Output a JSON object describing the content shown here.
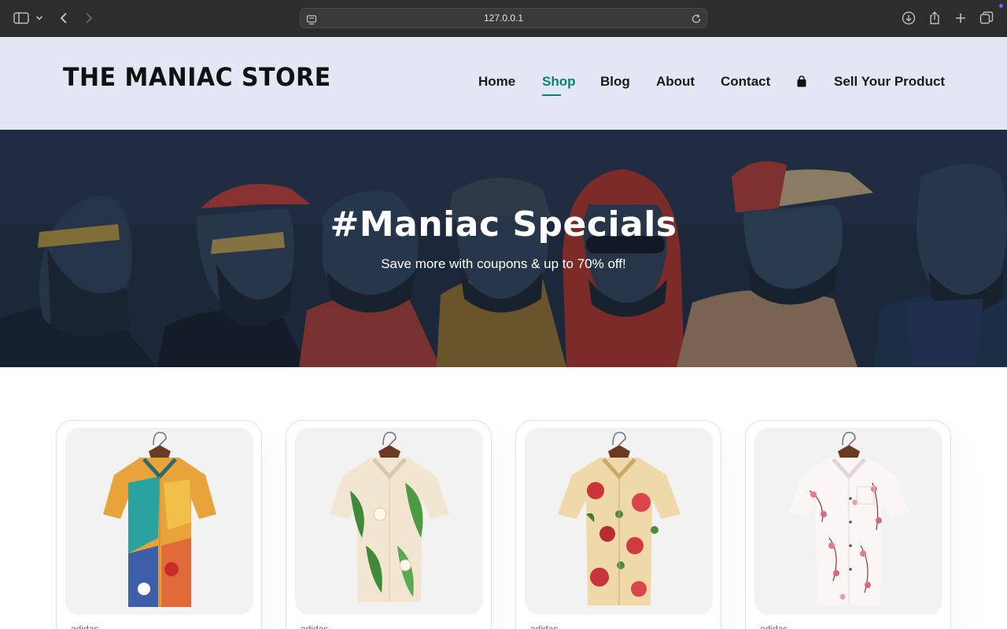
{
  "browser": {
    "url": "127.0.0.1",
    "icons": [
      "sidebar-icon",
      "chevron-down-icon",
      "back-icon",
      "forward-icon",
      "page-icon",
      "reload-icon",
      "download-icon",
      "share-icon",
      "new-tab-icon",
      "tabs-overview-icon"
    ]
  },
  "header": {
    "logo": "THE MANIAC STORE",
    "nav": [
      {
        "label": "Home",
        "active": false
      },
      {
        "label": "Shop",
        "active": true
      },
      {
        "label": "Blog",
        "active": false
      },
      {
        "label": "About",
        "active": false
      },
      {
        "label": "Contact",
        "active": false
      },
      {
        "label": "",
        "icon": "shopping-bag-icon"
      },
      {
        "label": "Sell Your Product",
        "active": false
      }
    ],
    "accent_color": "#088178",
    "background": "#e3e6f3"
  },
  "hero": {
    "title": "#Maniac Specials",
    "subtitle": "Save more with coupons & up to 70% off!"
  },
  "products": [
    {
      "image": "multicolor-abstract-shirt",
      "brand": "adidas"
    },
    {
      "image": "tropical-floral-shirt",
      "brand": "adidas"
    },
    {
      "image": "red-floral-shirt",
      "brand": "adidas"
    },
    {
      "image": "pink-blossom-shirt",
      "brand": "adidas"
    }
  ]
}
